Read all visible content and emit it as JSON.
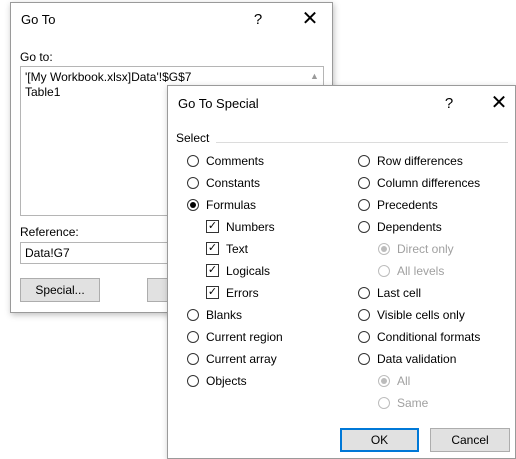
{
  "goto": {
    "title": "Go To",
    "help": "?",
    "close": "✕",
    "goto_label": "Go to:",
    "list_items": [
      "'[My Workbook.xlsx]Data'!$G$7",
      "Table1"
    ],
    "scroll_up": "▲",
    "reference_label": "Reference:",
    "reference_value": "Data!G7",
    "special_button": "Special..."
  },
  "special": {
    "title": "Go To Special",
    "help": "?",
    "close": "✕",
    "group_label": "Select",
    "left_options": [
      {
        "label": "Comments",
        "checked": false
      },
      {
        "label": "Constants",
        "checked": false
      },
      {
        "label": "Formulas",
        "checked": true
      },
      {
        "label": "Blanks",
        "checked": false
      },
      {
        "label": "Current region",
        "checked": false
      },
      {
        "label": "Current array",
        "checked": false
      },
      {
        "label": "Objects",
        "checked": false
      }
    ],
    "formula_types": [
      {
        "label": "Numbers",
        "checked": true
      },
      {
        "label": "Text",
        "checked": true
      },
      {
        "label": "Logicals",
        "checked": true
      },
      {
        "label": "Errors",
        "checked": true
      }
    ],
    "right_options": [
      {
        "label": "Row differences",
        "checked": false
      },
      {
        "label": "Column differences",
        "checked": false
      },
      {
        "label": "Precedents",
        "checked": false
      },
      {
        "label": "Dependents",
        "checked": false
      },
      {
        "label": "Direct only",
        "checked": true,
        "disabled": true
      },
      {
        "label": "All levels",
        "checked": false,
        "disabled": true
      },
      {
        "label": "Last cell",
        "checked": false
      },
      {
        "label": "Visible cells only",
        "checked": false
      },
      {
        "label": "Conditional formats",
        "checked": false
      },
      {
        "label": "Data validation",
        "checked": false
      },
      {
        "label": "All",
        "checked": true,
        "disabled": true
      },
      {
        "label": "Same",
        "checked": false,
        "disabled": true
      }
    ],
    "ok_button": "OK",
    "cancel_button": "Cancel"
  },
  "colors": {
    "accent": "#0078d7",
    "button_face": "#e1e1e1",
    "disabled_text": "#a0a0a0"
  }
}
